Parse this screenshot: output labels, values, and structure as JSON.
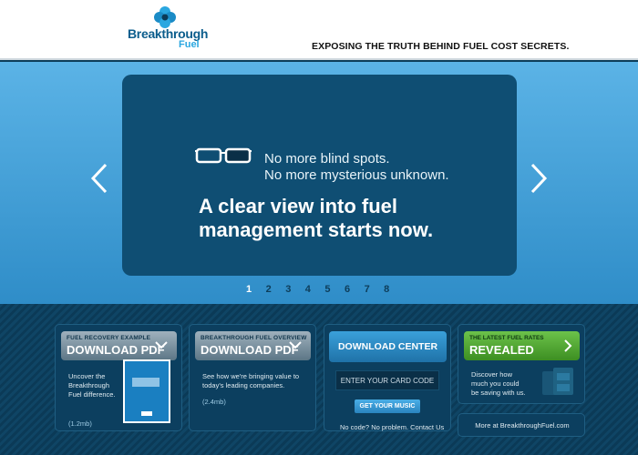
{
  "header": {
    "logo_text": "Breakthrough",
    "logo_sub": "Fuel",
    "tagline": "EXPOSING THE TRUTH BEHIND FUEL COST SECRETS."
  },
  "hero": {
    "line1": "No more blind spots.",
    "line2": "No more mysterious unknown.",
    "headline1": "A clear view into fuel",
    "headline2": "management starts now.",
    "pages": [
      "1",
      "2",
      "3",
      "4",
      "5",
      "6",
      "7",
      "8"
    ],
    "active_page": "1",
    "prev_icon": "chevron-left-icon",
    "next_icon": "chevron-right-icon"
  },
  "cards": {
    "recovery": {
      "small": "FUEL RECOVERY EXAMPLE",
      "big": "DOWNLOAD PDF",
      "text": "Uncover the Breakthrough Fuel difference.",
      "size": "(1.2mb)"
    },
    "overview": {
      "small": "BREAKTHROUGH FUEL OVERVIEW",
      "big": "DOWNLOAD PDF",
      "text": "See how we're bringing value to today's leading companies.",
      "size": "(2.4mb)"
    },
    "download_center": {
      "title": "DOWNLOAD CENTER",
      "input_placeholder": "ENTER YOUR CARD CODE",
      "music_button": "GET YOUR MUSIC",
      "nocode_text": "No code? No problem.",
      "contact_link": "Contact Us"
    },
    "rates": {
      "small": "THE LATEST FUEL RATES",
      "big": "REVEALED",
      "text": "Discover how much you could be saving with us."
    },
    "more": "More at BreakthroughFuel.com"
  },
  "colors": {
    "accent_blue": "#2aa7e0",
    "slide_bg": "#0f4e73",
    "green": "#6cc24a"
  }
}
